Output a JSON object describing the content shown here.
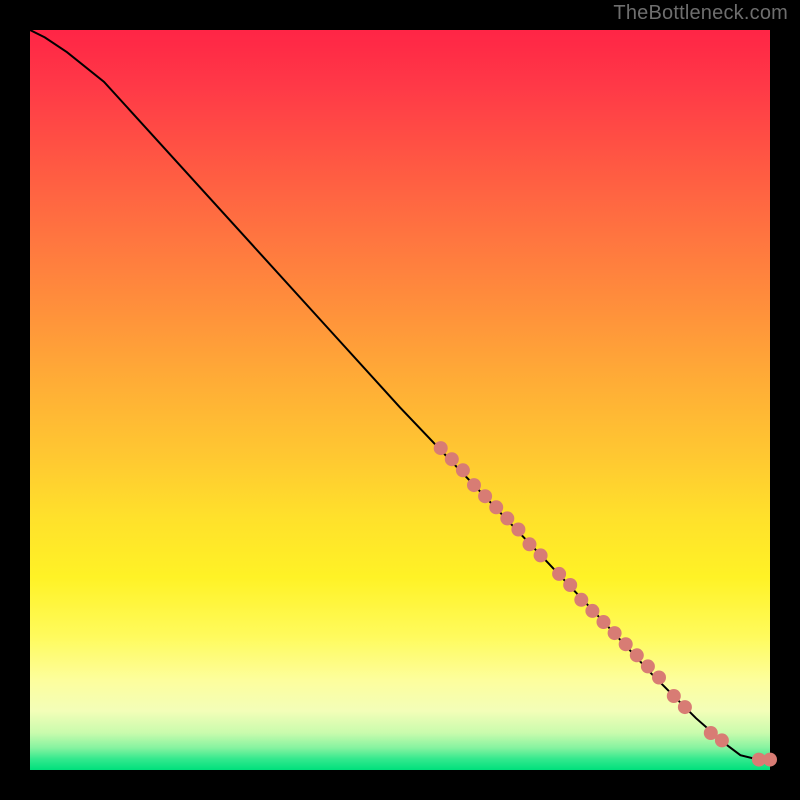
{
  "attribution": "TheBottleneck.com",
  "chart_data": {
    "type": "line",
    "title": "",
    "xlabel": "",
    "ylabel": "",
    "xlim": [
      0,
      100
    ],
    "ylim": [
      0,
      100
    ],
    "series": [
      {
        "name": "curve",
        "x": [
          0,
          2,
          5,
          10,
          20,
          30,
          40,
          50,
          60,
          70,
          78,
          84,
          90,
          94,
          96,
          98,
          100
        ],
        "y": [
          100,
          99,
          97,
          93,
          82,
          71,
          60,
          49,
          38.5,
          28,
          19.5,
          13,
          7,
          3.5,
          2,
          1.5,
          1.4
        ]
      }
    ],
    "scatter": {
      "name": "dots",
      "color": "#d87c74",
      "radius": 7,
      "points": [
        {
          "x": 55.5,
          "y": 43.5
        },
        {
          "x": 57.0,
          "y": 42.0
        },
        {
          "x": 58.5,
          "y": 40.5
        },
        {
          "x": 60.0,
          "y": 38.5
        },
        {
          "x": 61.5,
          "y": 37.0
        },
        {
          "x": 63.0,
          "y": 35.5
        },
        {
          "x": 64.5,
          "y": 34.0
        },
        {
          "x": 66.0,
          "y": 32.5
        },
        {
          "x": 67.5,
          "y": 30.5
        },
        {
          "x": 69.0,
          "y": 29.0
        },
        {
          "x": 71.5,
          "y": 26.5
        },
        {
          "x": 73.0,
          "y": 25.0
        },
        {
          "x": 74.5,
          "y": 23.0
        },
        {
          "x": 76.0,
          "y": 21.5
        },
        {
          "x": 77.5,
          "y": 20.0
        },
        {
          "x": 79.0,
          "y": 18.5
        },
        {
          "x": 80.5,
          "y": 17.0
        },
        {
          "x": 82.0,
          "y": 15.5
        },
        {
          "x": 83.5,
          "y": 14.0
        },
        {
          "x": 85.0,
          "y": 12.5
        },
        {
          "x": 87.0,
          "y": 10.0
        },
        {
          "x": 88.5,
          "y": 8.5
        },
        {
          "x": 92.0,
          "y": 5.0
        },
        {
          "x": 93.5,
          "y": 4.0
        },
        {
          "x": 98.5,
          "y": 1.4
        },
        {
          "x": 100.0,
          "y": 1.4
        }
      ]
    }
  }
}
